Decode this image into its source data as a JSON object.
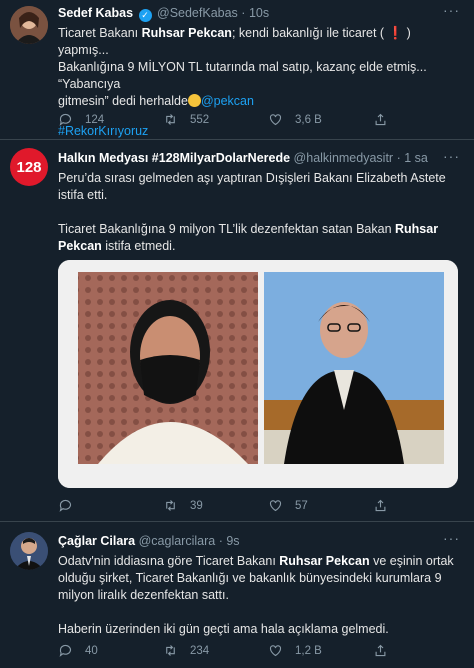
{
  "tweet1": {
    "name": "Sedef Kabas",
    "handle": "@SedefKabas",
    "sep": "·",
    "time": "10s",
    "line1_a": "Ticaret Bakanı ",
    "line1_bold": "Ruhsar Pekcan",
    "line1_b": "; kendi bakanlığı ile ticaret (",
    "line1_c": ") yapmış...",
    "line2": "Bakanlığına 9 MİLYON TL tutarında mal satıp, kazanç elde etmiş... “Yabancıya",
    "line3": "gitmesin” dedi herhalde",
    "mention": "@pekcan",
    "hashtag": "#RekorKırıyoruz",
    "replies": "124",
    "retweets": "552",
    "likes": "3,6 B"
  },
  "tweet2": {
    "name": "Halkın Medyası #128MilyarDolarNerede",
    "handle": "@halkinmedyasitr",
    "sep": "·",
    "time": "1 sa",
    "avatar_text": "128",
    "para1": "Peru’da sırası gelmeden aşı yaptıran Dışişleri Bakanı Elizabeth Astete istifa etti.",
    "para2_a": "Ticaret Bakanlığına 9 milyon TL’lik dezenfektan satan Bakan ",
    "para2_bold": "Ruhsar Pekcan",
    "para2_b": " istifa etmedi.",
    "replies": "",
    "retweets": "39",
    "likes": "57"
  },
  "tweet3": {
    "name": "Çağlar Cilara",
    "handle": "@caglarcilara",
    "sep": "·",
    "time": "9s",
    "para1_a": "Odatv'nin iddiasına göre Ticaret Bakanı ",
    "para1_bold": "Ruhsar Pekcan",
    "para1_b": " ve eşinin ortak olduğu şirket, Ticaret Bakanlığı ve bakanlık bünyesindeki kurumlara 9 milyon liralık dezenfektan sattı.",
    "para2": "Haberin üzerinden iki gün geçti ama hala açıklama gelmedi.",
    "replies": "40",
    "retweets": "234",
    "likes": "1,2 B"
  },
  "colors": {
    "background": "#15202b",
    "accent": "#1da1f2",
    "muted": "#8899a6",
    "divider": "#38444d",
    "avatar128": "#e0192b"
  },
  "icons": [
    "reply-icon",
    "retweet-icon",
    "like-icon",
    "share-icon",
    "more-icon",
    "verified-icon",
    "red-exclamation-icon",
    "laughing-emoji-icon"
  ]
}
